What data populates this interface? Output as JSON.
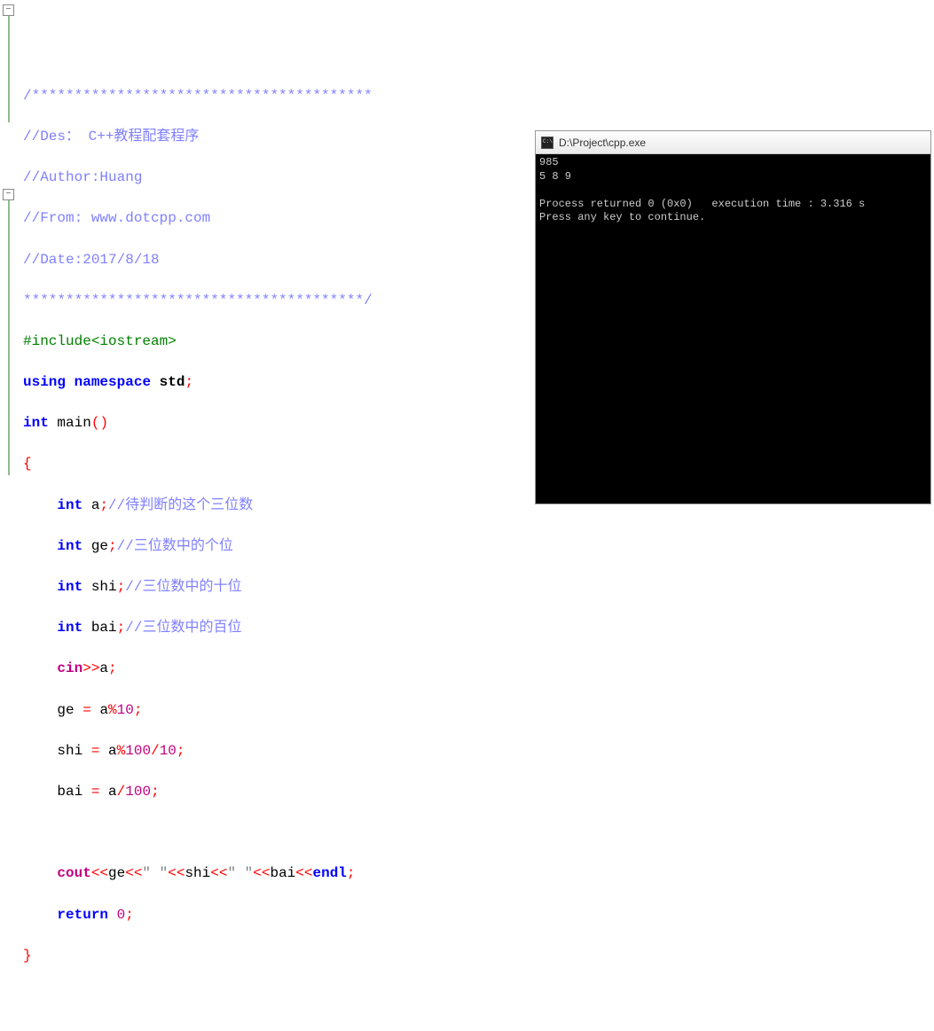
{
  "code": {
    "stars1": "/****************************************",
    "des": "//Des： C++教程配套程序",
    "author": "//Author:Huang",
    "from": "//From: www.dotcpp.com",
    "date": "//Date:2017/8/18",
    "stars2": "****************************************/",
    "include_hash": "#include",
    "include_lib": "<iostream>",
    "using": "using",
    "namespace": "namespace",
    "std": "std",
    "semi": ";",
    "int": "int",
    "main": "main",
    "lparen": "(",
    "rparen": ")",
    "lbrace": "{",
    "rbrace": "}",
    "var_a": "a",
    "var_ge": "ge",
    "var_shi": "shi",
    "var_bai": "bai",
    "cmt_a": "//待判断的这个三位数",
    "cmt_ge": "//三位数中的个位",
    "cmt_shi": "//三位数中的十位",
    "cmt_bai": "//三位数中的百位",
    "cin": "cin",
    "gtgt": ">>",
    "eq": "=",
    "pct": "%",
    "slash": "/",
    "n10": "10",
    "n100": "100",
    "cout": "cout",
    "ltlt": "<<",
    "space_str": "\" \"",
    "endl": "endl",
    "return": "return",
    "zero": "0"
  },
  "console": {
    "title": "D:\\Project\\cpp.exe",
    "line1": "985",
    "line2": "5 8 9",
    "blank": "",
    "status": "Process returned 0 (0x0)   execution time : 3.316 s",
    "prompt": "Press any key to continue."
  }
}
